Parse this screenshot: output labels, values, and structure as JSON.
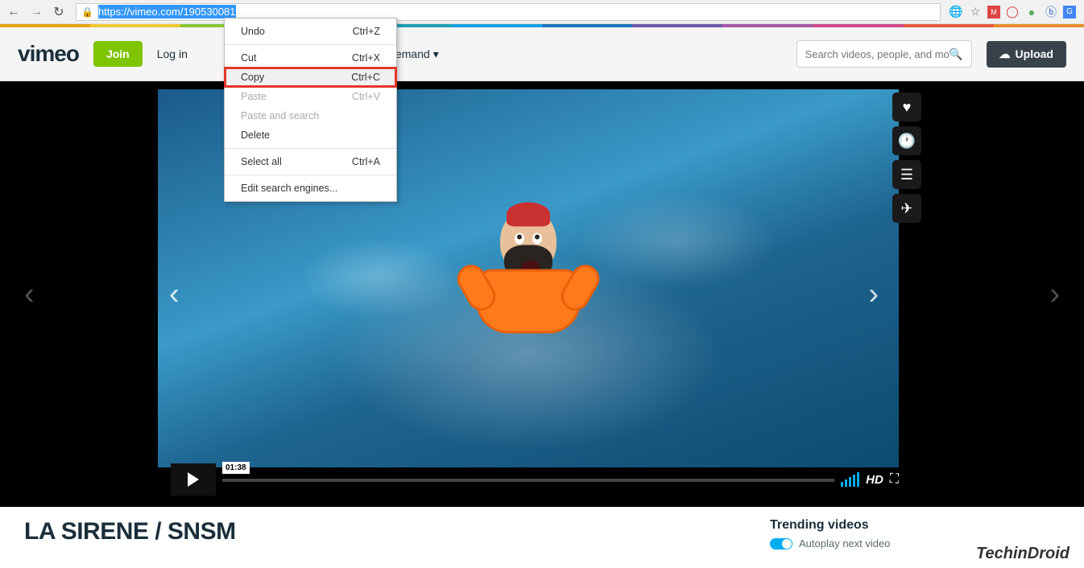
{
  "browser": {
    "url_prefix": "https://",
    "url_rest": "vimeo.com/190530081",
    "ext_icons": [
      "translate",
      "star",
      "gmail",
      "opera",
      "adblock",
      "bitly",
      "gtranslate"
    ]
  },
  "rainbow_colors": [
    "#e7a614",
    "#f0c830",
    "#8ac535",
    "#3bb34a",
    "#1fa0b3",
    "#17a0e0",
    "#2076c0",
    "#6f5aa8",
    "#a85aa8",
    "#d14a8c",
    "#e55a42",
    "#e89030"
  ],
  "header": {
    "logo": "vimeo",
    "join": "Join",
    "login": "Log in",
    "demand": "Demand",
    "search_placeholder": "Search videos, people, and more",
    "upload": "Upload"
  },
  "context_menu": [
    {
      "label": "Undo",
      "shortcut": "Ctrl+Z",
      "disabled": false
    },
    {
      "sep": true
    },
    {
      "label": "Cut",
      "shortcut": "Ctrl+X",
      "disabled": false
    },
    {
      "label": "Copy",
      "shortcut": "Ctrl+C",
      "disabled": false,
      "highlight": true,
      "hover": true
    },
    {
      "label": "Paste",
      "shortcut": "Ctrl+V",
      "disabled": true
    },
    {
      "label": "Paste and search",
      "shortcut": "",
      "disabled": true
    },
    {
      "label": "Delete",
      "shortcut": "",
      "disabled": false
    },
    {
      "sep": true
    },
    {
      "label": "Select all",
      "shortcut": "Ctrl+A",
      "disabled": false
    },
    {
      "sep": true
    },
    {
      "label": "Edit search engines...",
      "shortcut": "",
      "disabled": false
    }
  ],
  "player": {
    "time": "01:38",
    "hd": "HD"
  },
  "video": {
    "title": "LA SIRENE / SNSM"
  },
  "sidebar": {
    "trending": "Trending videos",
    "autoplay": "Autoplay next video"
  },
  "watermark": "TechinDroid"
}
